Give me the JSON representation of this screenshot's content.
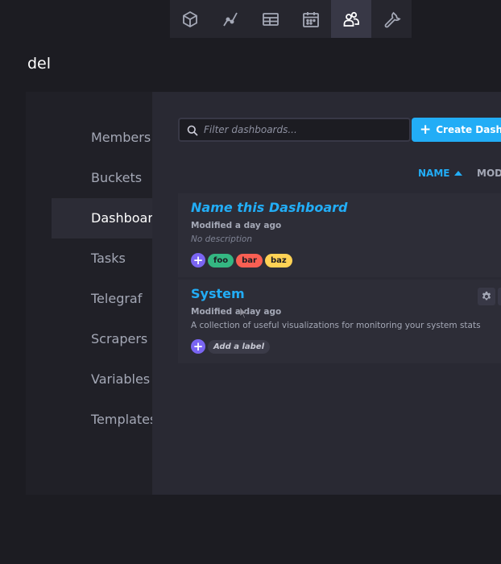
{
  "nav": {
    "items": [
      {
        "icon": "cube-icon",
        "active": false
      },
      {
        "icon": "graph-icon",
        "active": false
      },
      {
        "icon": "table-icon",
        "active": false
      },
      {
        "icon": "calendar-icon",
        "active": false
      },
      {
        "icon": "users-icon",
        "active": true
      },
      {
        "icon": "wrench-icon",
        "active": false
      }
    ]
  },
  "org": {
    "name": "del"
  },
  "tabs": [
    {
      "label": "Members"
    },
    {
      "label": "Buckets"
    },
    {
      "label": "Dashboards",
      "active": true
    },
    {
      "label": "Tasks"
    },
    {
      "label": "Telegraf"
    },
    {
      "label": "Scrapers"
    },
    {
      "label": "Variables"
    },
    {
      "label": "Templates"
    }
  ],
  "toolbar": {
    "search_placeholder": "Filter dashboards...",
    "create_label": "Create Dashboard"
  },
  "sort": {
    "name_label": "NAME",
    "modified_label": "MODIFIED"
  },
  "dashboards": [
    {
      "name": "Name this Dashboard",
      "modified": "Modified a day ago",
      "description": "No description",
      "labels": [
        {
          "name": "foo",
          "color": "#34b782"
        },
        {
          "name": "bar",
          "color": "#f95f53"
        },
        {
          "name": "baz",
          "color": "#ffd255"
        }
      ]
    },
    {
      "name": "System",
      "modified": "Modified a day ago",
      "description": "A collection of useful visualizations for monitoring your system stats",
      "add_label_text": "Add a label"
    }
  ],
  "colors": {
    "accent": "#22adf6",
    "label_add": "#7a65f2",
    "background": "#1c1c22"
  }
}
